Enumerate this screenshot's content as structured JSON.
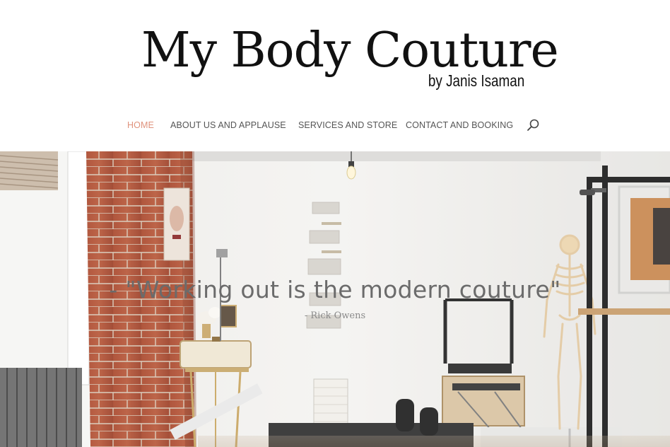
{
  "logo": {
    "title": "My Body Couture",
    "subtitle": "by Janis Isaman"
  },
  "nav": {
    "items": [
      {
        "label": "HOME",
        "active": true
      },
      {
        "label": "ABOUT US AND APPLAUSE",
        "active": false
      },
      {
        "label": "SERVICES AND STORE",
        "active": false
      },
      {
        "label": "CONTACT AND BOOKING",
        "active": false
      }
    ],
    "search_icon": "search-icon"
  },
  "hero": {
    "quote": "- \"Working out is the modern couture\"",
    "author": "- Rick Owens"
  },
  "colors": {
    "accent": "#e0937d",
    "nav_text": "#555555",
    "logo_text": "#111111"
  }
}
